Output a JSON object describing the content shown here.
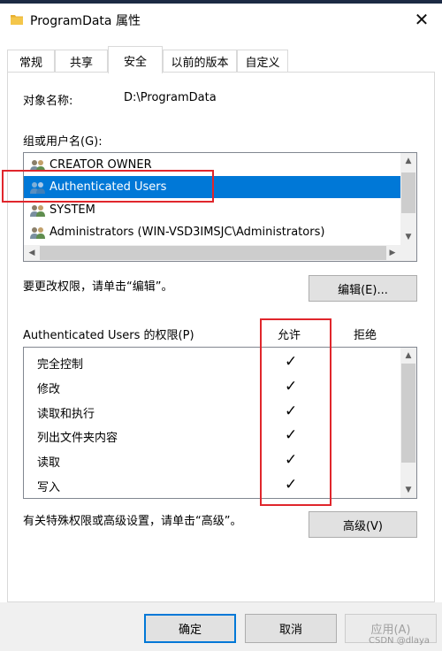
{
  "window": {
    "title": "ProgramData 属性",
    "close_glyph": "✕"
  },
  "tabs": [
    {
      "label": "常规",
      "active": false
    },
    {
      "label": "共享",
      "active": false
    },
    {
      "label": "安全",
      "active": true
    },
    {
      "label": "以前的版本",
      "active": false
    },
    {
      "label": "自定义",
      "active": false
    }
  ],
  "security": {
    "object_name_label": "对象名称:",
    "object_name_value": "D:\\ProgramData",
    "groups_label": "组或用户名(G):",
    "users": [
      {
        "name": "CREATOR OWNER",
        "selected": false
      },
      {
        "name": "Authenticated Users",
        "selected": true
      },
      {
        "name": "SYSTEM",
        "selected": false
      },
      {
        "name": "Administrators (WIN-VSD3IMSJC\\Administrators)",
        "selected": false
      }
    ],
    "edit_hint": "要更改权限，请单击“编辑”。",
    "edit_button": "编辑(E)...",
    "permissions_label": "Authenticated Users 的权限(P)",
    "allow_header": "允许",
    "deny_header": "拒绝",
    "permissions": [
      {
        "name": "完全控制",
        "allow": "✓",
        "deny": ""
      },
      {
        "name": "修改",
        "allow": "✓",
        "deny": ""
      },
      {
        "name": "读取和执行",
        "allow": "✓",
        "deny": ""
      },
      {
        "name": "列出文件夹内容",
        "allow": "✓",
        "deny": ""
      },
      {
        "name": "读取",
        "allow": "✓",
        "deny": ""
      },
      {
        "name": "写入",
        "allow": "✓",
        "deny": ""
      }
    ],
    "advanced_hint": "有关特殊权限或高级设置，请单击“高级”。",
    "advanced_button": "高级(V)"
  },
  "footer": {
    "ok_button": "确定",
    "cancel_button": "取消",
    "apply_button": "应用(A)"
  },
  "watermark": "CSDN @dlaya",
  "colors": {
    "selection": "#0078d7",
    "highlight_annotation": "#e0262c"
  },
  "icons": {
    "folder": "folder-icon",
    "user_group": "user-group-icon"
  }
}
